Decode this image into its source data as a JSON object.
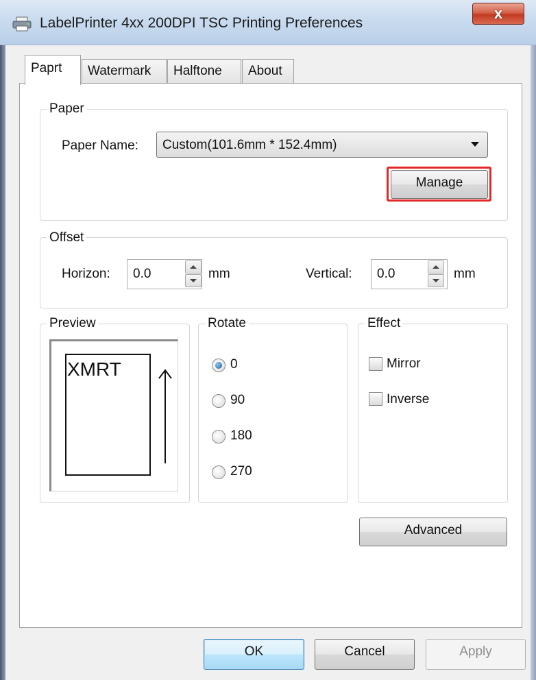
{
  "window": {
    "title": "LabelPrinter 4xx 200DPI TSC Printing Preferences",
    "close_glyph": "x"
  },
  "tabs": [
    {
      "label": "Paprt",
      "active": true
    },
    {
      "label": "Watermark",
      "active": false
    },
    {
      "label": "Halftone",
      "active": false
    },
    {
      "label": "About",
      "active": false
    }
  ],
  "paper": {
    "group_label": "Paper",
    "name_label": "Paper Name:",
    "name_value": "Custom(101.6mm * 152.4mm)",
    "manage_label": "Manage",
    "highlight_color": "#e32727"
  },
  "offset": {
    "group_label": "Offset",
    "horizon_label": "Horizon:",
    "horizon_value": "0.0",
    "horizon_unit": "mm",
    "vertical_label": "Vertical:",
    "vertical_value": "0.0",
    "vertical_unit": "mm"
  },
  "preview": {
    "group_label": "Preview",
    "sample_text": "XMRT"
  },
  "rotate": {
    "group_label": "Rotate",
    "options": [
      "0",
      "90",
      "180",
      "270"
    ],
    "selected": "0"
  },
  "effect": {
    "group_label": "Effect",
    "mirror_label": "Mirror",
    "mirror_checked": false,
    "inverse_label": "Inverse",
    "inverse_checked": false
  },
  "advanced_label": "Advanced",
  "footer": {
    "ok_label": "OK",
    "cancel_label": "Cancel",
    "apply_label": "Apply"
  }
}
